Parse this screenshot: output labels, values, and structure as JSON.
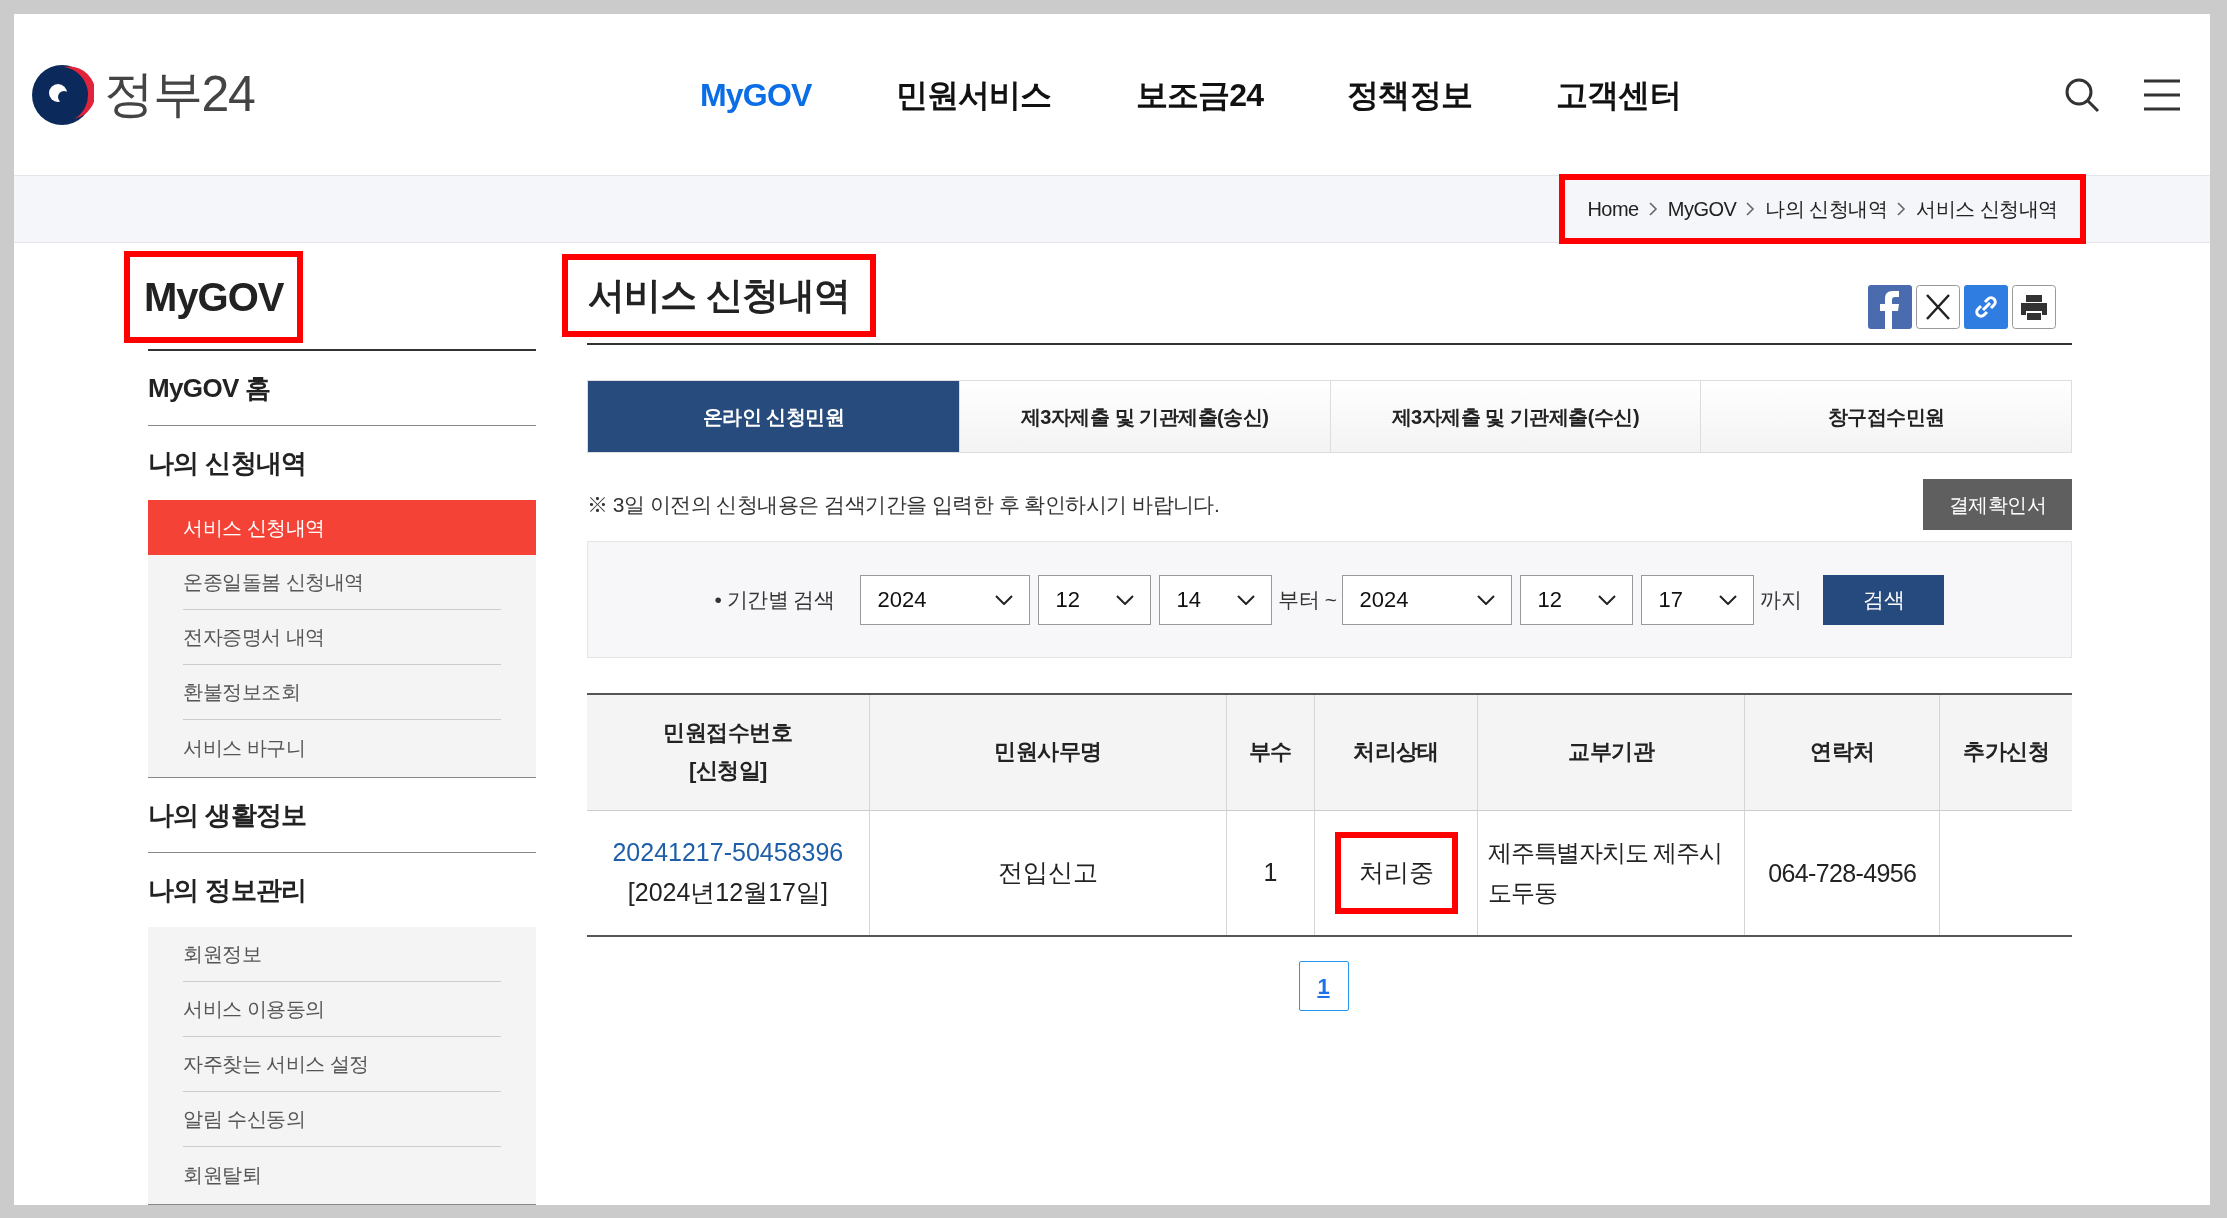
{
  "header": {
    "logo_text": "정부24",
    "nav": [
      {
        "label": "MyGOV",
        "selected": true
      },
      {
        "label": "민원서비스",
        "selected": false
      },
      {
        "label": "보조금24",
        "selected": false
      },
      {
        "label": "정책정보",
        "selected": false
      },
      {
        "label": "고객센터",
        "selected": false
      }
    ]
  },
  "breadcrumb": {
    "highlighted": true,
    "items": [
      "Home",
      "MyGOV",
      "나의 신청내역",
      "서비스 신청내역"
    ]
  },
  "sidebar": {
    "title": "MyGOV",
    "title_highlighted": true,
    "sections": [
      {
        "label": "MyGOV 홈"
      },
      {
        "label": "나의 신청내역",
        "children": [
          {
            "label": "서비스 신청내역",
            "selected": true
          },
          {
            "label": "온종일돌봄 신청내역",
            "selected": false
          },
          {
            "label": "전자증명서 내역",
            "selected": false
          },
          {
            "label": "환불정보조회",
            "selected": false
          },
          {
            "label": "서비스 바구니",
            "selected": false
          }
        ]
      },
      {
        "label": "나의 생활정보"
      },
      {
        "label": "나의 정보관리",
        "children": [
          {
            "label": "회원정보",
            "selected": false
          },
          {
            "label": "서비스 이용동의",
            "selected": false
          },
          {
            "label": "자주찾는 서비스 설정",
            "selected": false
          },
          {
            "label": "알림 수신동의",
            "selected": false
          },
          {
            "label": "회원탈퇴",
            "selected": false
          }
        ]
      }
    ]
  },
  "main": {
    "title": "서비스 신청내역",
    "title_highlighted": true,
    "tabs": [
      {
        "label": "온라인 신청민원",
        "selected": true
      },
      {
        "label": "제3자제출 및 기관제출(송신)",
        "selected": false
      },
      {
        "label": "제3자제출 및 기관제출(수신)",
        "selected": false
      },
      {
        "label": "창구접수민원",
        "selected": false
      }
    ],
    "notice": "※ 3일 이전의 신청내용은 검색기간을 입력한 후 확인하시기 바랍니다.",
    "receipt_button": "결제확인서",
    "search": {
      "label": "• 기간별 검색",
      "from": [
        "2024",
        "12",
        "14"
      ],
      "from_suffix": "부터 ~",
      "to": [
        "2024",
        "12",
        "17"
      ],
      "to_suffix": "까지",
      "button": "검색"
    },
    "table": {
      "columns": [
        "민원접수번호\n[신청일]",
        "민원사무명",
        "부수",
        "처리상태",
        "교부기관",
        "연락처",
        "추가신청"
      ],
      "rows": [
        {
          "receipt_no": "20241217-50458396",
          "date": "[2024년12월17일]",
          "service": "전입신고",
          "copies": "1",
          "status": "처리중",
          "status_highlighted": true,
          "agency": "제주특별자치도 제주시 도두동",
          "contact": "064-728-4956"
        }
      ]
    },
    "pagination": [
      {
        "label": "1",
        "selected": true
      }
    ]
  }
}
